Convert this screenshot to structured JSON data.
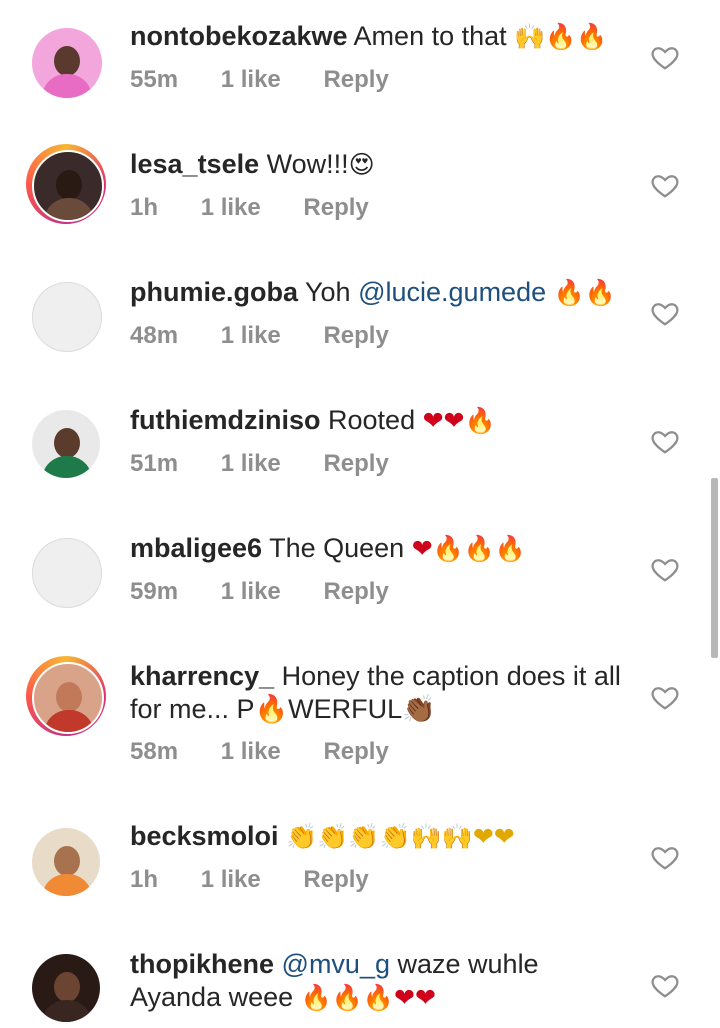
{
  "comments": [
    {
      "username": "nontobekozakwe",
      "text": "Amen to that",
      "emoji": "🙌🔥🔥",
      "time": "55m",
      "likes": "1 like",
      "reply": "Reply",
      "avatar_bg": "#f3a6dc",
      "face": "#5a3a2e",
      "body": "#e86bc4"
    },
    {
      "username": "lesa_tsele",
      "text": "Wow!!!",
      "emoji": "😍",
      "time": "1h",
      "likes": "1 like",
      "reply": "Reply",
      "avatar_bg": "#3b2a2a",
      "face": "#2a1a14",
      "body": "#6a4a3a"
    },
    {
      "username": "phumie.goba",
      "text": "Yoh",
      "mention": "@lucie.gumede",
      "emoji": "🔥🔥",
      "time": "48m",
      "likes": "1 like",
      "reply": "Reply"
    },
    {
      "username": "futhiemdziniso",
      "text": "Rooted",
      "emoji": "❤❤🔥",
      "time": "51m",
      "likes": "1 like",
      "reply": "Reply",
      "avatar_bg": "#e9e9e9",
      "face": "#5b3b2b",
      "body": "#1f7a4a"
    },
    {
      "username": "mbaligee6",
      "text": "The Queen",
      "emoji": "❤🔥🔥🔥",
      "time": "59m",
      "likes": "1 like",
      "reply": "Reply"
    },
    {
      "username": "kharrency_",
      "text": "Honey the caption does it all for me... P🔥WERFUL👏🏾",
      "time": "58m",
      "likes": "1 like",
      "reply": "Reply",
      "avatar_bg": "#d9a38a",
      "face": "#c07a5a",
      "body": "#c0392b"
    },
    {
      "username": "becksmoloi",
      "text": "",
      "emoji": "👏👏👏👏🙌🙌❤❤",
      "time": "1h",
      "likes": "1 like",
      "reply": "Reply",
      "avatar_bg": "#e8dcc8",
      "face": "#a8724e",
      "body": "#f08a34"
    },
    {
      "username": "thopikhene",
      "mention": "@mvu_g",
      "text": "waze wuhle Ayanda weee",
      "emoji": "🔥🔥🔥❤❤",
      "avatar_bg": "#2a1a16",
      "face": "#6b4532",
      "body": "#3a2620"
    }
  ]
}
